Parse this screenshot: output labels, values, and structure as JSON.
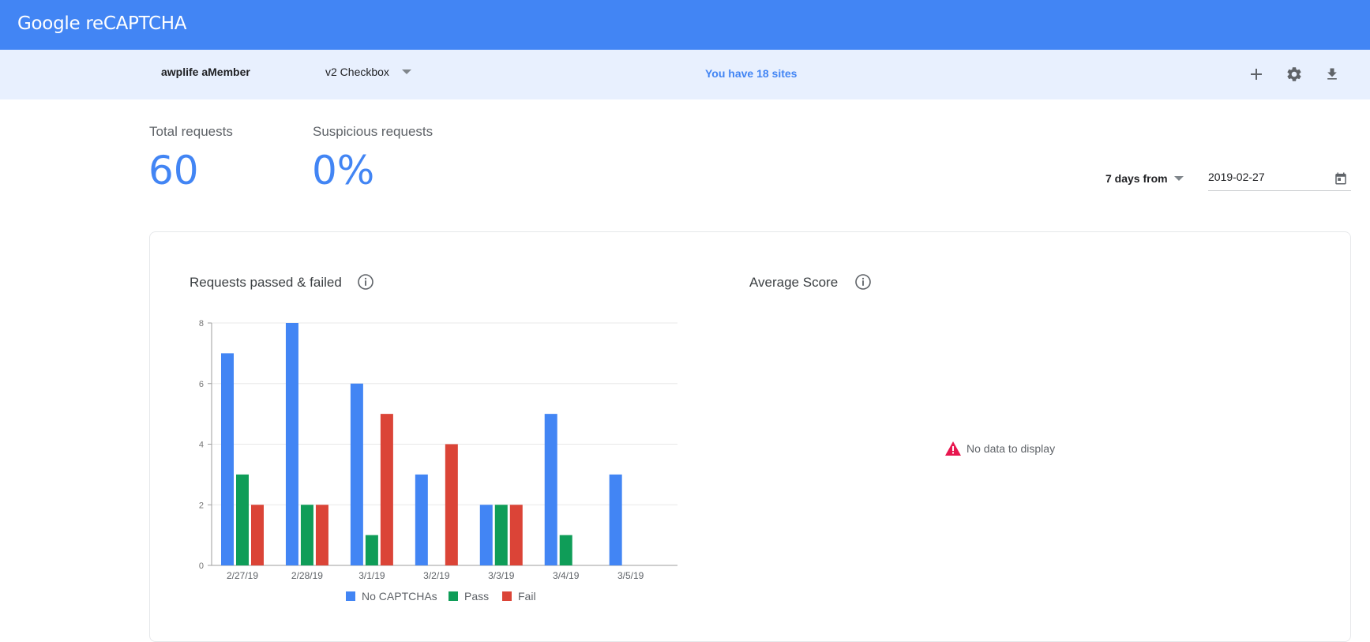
{
  "header": {
    "brand": "Google reCAPTCHA",
    "brand_color": "#4285f4"
  },
  "subbar": {
    "site_name": "awplife aMember",
    "key_type": "v2 Checkbox",
    "sites_count": "You have 18 sites",
    "icons": [
      "add-icon",
      "gear-icon",
      "download-icon"
    ]
  },
  "stats": {
    "total_label": "Total requests",
    "total_value": "60",
    "suspicious_label": "Suspicious requests",
    "suspicious_value": "0%"
  },
  "range": {
    "label": "7 days from",
    "date": "2019-02-27"
  },
  "charts": {
    "left_title": "Requests passed & failed",
    "right_title": "Average Score",
    "no_data": "No data to display"
  },
  "chart_data": {
    "type": "bar",
    "categories": [
      "2/27/19",
      "2/28/19",
      "3/1/19",
      "3/2/19",
      "3/3/19",
      "3/4/19",
      "3/5/19"
    ],
    "series": [
      {
        "name": "No CAPTCHAs",
        "color": "#4285f4",
        "values": [
          7,
          8,
          6,
          3,
          2,
          5,
          3
        ]
      },
      {
        "name": "Pass",
        "color": "#0f9d58",
        "values": [
          3,
          2,
          1,
          0,
          2,
          1,
          0
        ]
      },
      {
        "name": "Fail",
        "color": "#db4437",
        "values": [
          2,
          2,
          5,
          4,
          2,
          0,
          0
        ]
      }
    ],
    "y_ticks": [
      0,
      2,
      4,
      6,
      8
    ],
    "ylim": [
      0,
      8
    ],
    "grid": true,
    "legend": "bottom"
  }
}
